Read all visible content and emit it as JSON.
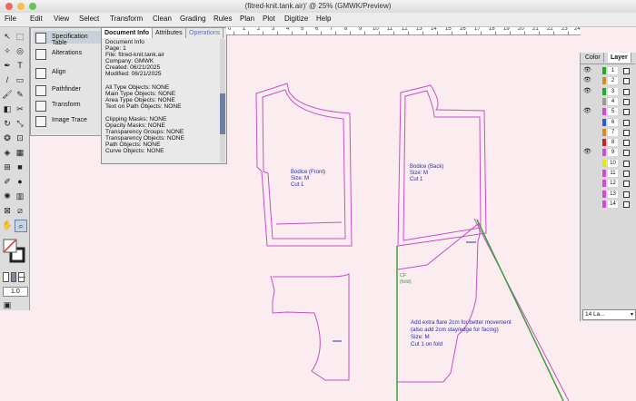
{
  "window": {
    "title": "(fitred-knit.tank.air)' @ 25% (GMWK/Preview)"
  },
  "menu": [
    "File",
    "Edit",
    "View",
    "Select",
    "Transform",
    "Clean",
    "Grading",
    "Rules",
    "Plan",
    "Plot",
    "Digitize",
    "Help"
  ],
  "side_panel": {
    "items": [
      "Specification Table",
      "Alterations",
      "Align",
      "Pathfinder",
      "Transform",
      "Image Trace"
    ]
  },
  "doc_panel": {
    "tabs": [
      "Document Info",
      "Attributes",
      "Operations"
    ],
    "lines": [
      "Document Info",
      "Page: 1",
      "File: fitred-knit.tank.air",
      "Company: GMWK",
      "Created: 06/21/2025",
      "Modified: 06/21/2025",
      "",
      "All Type Objects: NONE",
      "Main Type Objects: NONE",
      "Area Type Objects: NONE",
      "Text on Path Objects: NONE",
      "",
      "Clipping Masks: NONE",
      "Opacity Masks: NONE",
      "Transparency Groups: NONE",
      "Transparency Objects: NONE",
      "Path Objects: NONE",
      "Curve Objects: NONE"
    ]
  },
  "ruler": {
    "labels": [
      "0",
      "1",
      "2",
      "3",
      "4",
      "5",
      "6",
      "7",
      "8",
      "9",
      "10",
      "11",
      "12",
      "13",
      "14",
      "15",
      "16",
      "17",
      "18",
      "19",
      "20",
      "21",
      "22",
      "23",
      "24"
    ]
  },
  "canvas": {
    "front_label": [
      "Bodice (Front)",
      "Size: M",
      "Cut 1"
    ],
    "back_label": [
      "Bodice (Back)",
      "Size: M",
      "Cut 1"
    ],
    "cf_label": [
      "CF",
      "(fold)"
    ],
    "skirt_note": [
      "Add extra flare 2cm for better movement",
      "(also add 2cm stay/edge for facing)",
      "Size: M",
      "Cut 1 on fold"
    ]
  },
  "tools": {
    "zoom_value": "1.0"
  },
  "layers_panel": {
    "tabs": [
      "Color",
      "Layer"
    ],
    "layers": [
      {
        "num": "1",
        "color": "#22aa22",
        "eye": true
      },
      {
        "num": "2",
        "color": "#d98c1a",
        "eye": true
      },
      {
        "num": "3",
        "color": "#22aa22",
        "eye": true
      },
      {
        "num": "4",
        "color": "#9a9a9a",
        "eye": false
      },
      {
        "num": "5",
        "color": "#d14ad1",
        "eye": true
      },
      {
        "num": "6",
        "color": "#2d5bd6",
        "eye": false
      },
      {
        "num": "7",
        "color": "#d98c1a",
        "eye": false
      },
      {
        "num": "8",
        "color": "#cc2222",
        "eye": false
      },
      {
        "num": "9",
        "color": "#d14ad1",
        "eye": true
      },
      {
        "num": "10",
        "color": "#e6e600",
        "eye": false
      },
      {
        "num": "11",
        "color": "#d14ad1",
        "eye": false
      },
      {
        "num": "12",
        "color": "#d14ad1",
        "eye": false
      },
      {
        "num": "13",
        "color": "#d14ad1",
        "eye": false
      },
      {
        "num": "14",
        "color": "#d14ad1",
        "eye": false
      }
    ],
    "status": "14 La..."
  }
}
